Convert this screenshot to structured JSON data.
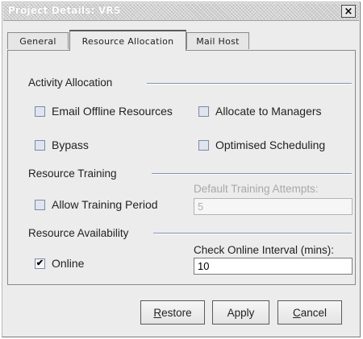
{
  "window": {
    "title": "Project Details: VRS",
    "close_label": "×"
  },
  "tabs": [
    {
      "label": "General"
    },
    {
      "label": "Resource Allocation"
    },
    {
      "label": "Mail Host"
    }
  ],
  "activity_allocation": {
    "title": "Activity Allocation",
    "email_offline": {
      "label": "Email Offline Resources",
      "checked": false
    },
    "allocate_managers": {
      "label": "Allocate to Managers",
      "checked": false
    },
    "bypass": {
      "label": "Bypass",
      "checked": false
    },
    "optimised": {
      "label": "Optimised Scheduling",
      "checked": false
    }
  },
  "resource_training": {
    "title": "Resource Training",
    "allow_training": {
      "label": "Allow Training Period",
      "checked": false
    },
    "attempts_label": "Default Training Attempts:",
    "attempts_value": "5"
  },
  "resource_availability": {
    "title": "Resource Availability",
    "online": {
      "label": "Online",
      "checked": true,
      "mark": "✔"
    },
    "interval_label": "Check Online Interval (mins):",
    "interval_value": "10"
  },
  "buttons": {
    "restore": {
      "mnemonic": "R",
      "rest": "estore"
    },
    "apply": {
      "label": "Apply"
    },
    "cancel": {
      "mnemonic": "C",
      "rest": "ancel"
    }
  }
}
